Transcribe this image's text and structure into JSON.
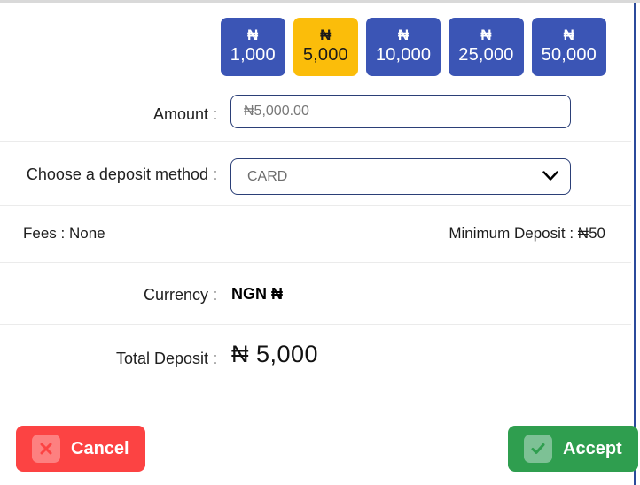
{
  "dialog": {
    "quick_amounts": [
      {
        "symbol": "₦",
        "value": "1,000",
        "selected": false
      },
      {
        "symbol": "₦",
        "value": "5,000",
        "selected": true
      },
      {
        "symbol": "₦",
        "value": "10,000",
        "selected": false
      },
      {
        "symbol": "₦",
        "value": "25,000",
        "selected": false
      },
      {
        "symbol": "₦",
        "value": "50,000",
        "selected": false
      }
    ],
    "amount": {
      "label": "Amount :",
      "value": "₦5,000.00",
      "placeholder": "₦5,000.00"
    },
    "method": {
      "label": "Choose a deposit method :",
      "selected": "CARD",
      "options": [
        "CARD"
      ],
      "chevron_icon": "chevron-down-icon"
    },
    "fees": {
      "left": "Fees : None",
      "right": "Minimum Deposit : ₦50"
    },
    "currency": {
      "label": "Currency :",
      "value": "NGN ₦"
    },
    "total": {
      "label": "Total Deposit :",
      "value": "₦ 5,000"
    },
    "actions": {
      "cancel_label": "Cancel",
      "cancel_icon": "close-x-icon",
      "accept_label": "Accept",
      "accept_icon": "checkmark-icon"
    },
    "colors": {
      "quick_default": "#3b55b5",
      "quick_selected": "#fbbd0a",
      "cancel": "#fc4343",
      "accept": "#2f9e4f",
      "field_border": "#2b3f77",
      "window_border": "#2b4a9b"
    }
  }
}
